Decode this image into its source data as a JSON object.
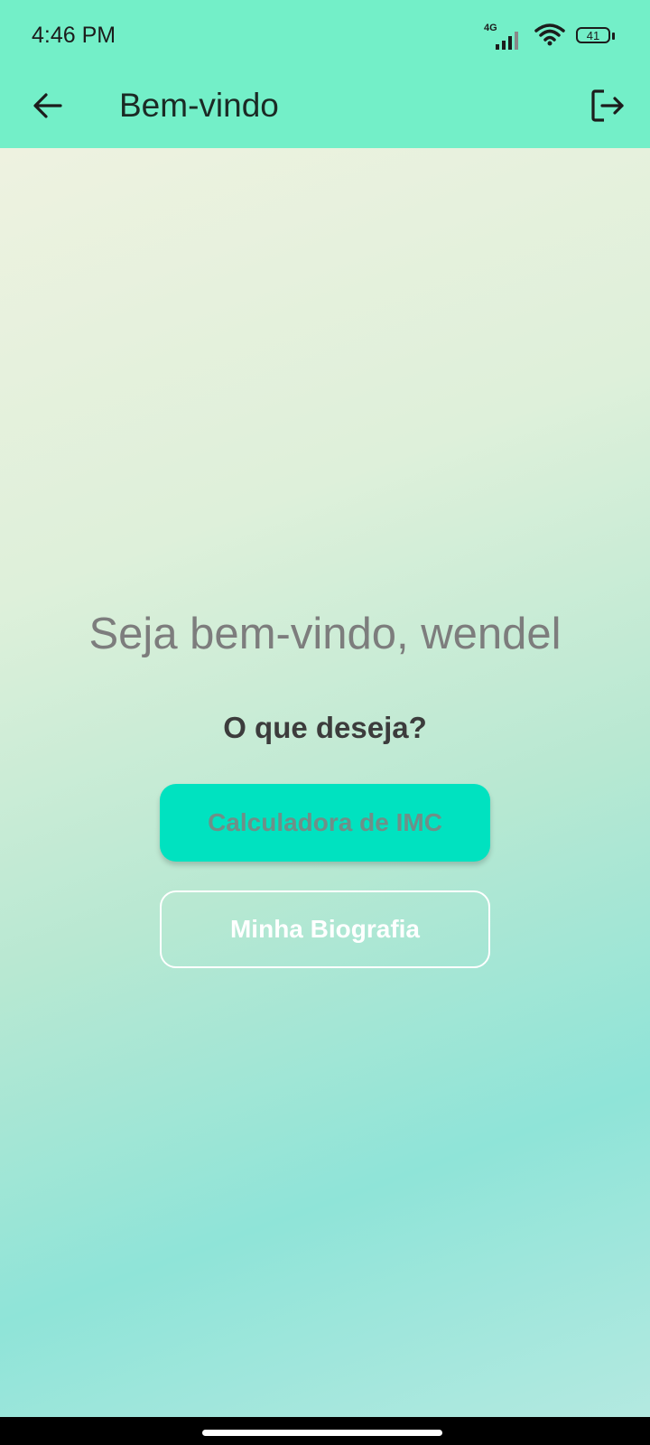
{
  "status_bar": {
    "time": "4:46 PM",
    "network_label": "4G",
    "battery_level": "41",
    "icons": [
      "signal-icon",
      "wifi-icon",
      "battery-icon"
    ]
  },
  "app_bar": {
    "title": "Bem-vindo",
    "back_icon": "arrow-back-icon",
    "logout_icon": "logout-icon"
  },
  "main": {
    "welcome_text": "Seja bem-vindo, wendel",
    "question_text": "O que deseja?",
    "buttons": [
      {
        "label": "Calculadora de IMC"
      },
      {
        "label": "Minha Biografia"
      }
    ]
  },
  "colors": {
    "app_bar_bg": "#73EFC8",
    "primary_button_bg": "#00E2C0",
    "gradient_top": "#EEF2E0",
    "gradient_bottom": "#8FE4D8"
  }
}
